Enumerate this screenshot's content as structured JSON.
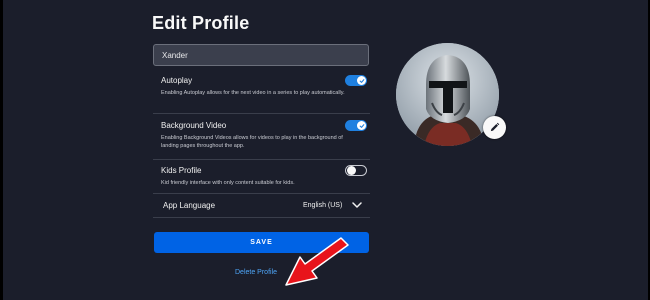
{
  "page": {
    "title": "Edit Profile"
  },
  "profile": {
    "name_value": "Xander"
  },
  "settings": [
    {
      "label": "Autoplay",
      "description": "Enabling Autoplay allows for the next video in a series to play automatically.",
      "enabled": true
    },
    {
      "label": "Background Video",
      "description": "Enabling Background Videos allows for videos to play in the background of landing pages throughout the app.",
      "enabled": true
    },
    {
      "label": "Kids Profile",
      "description": "Kid friendly interface with only content suitable for kids.",
      "enabled": false
    }
  ],
  "language": {
    "label": "App Language",
    "value": "English (US)"
  },
  "actions": {
    "save_label": "SAVE",
    "delete_label": "Delete Profile"
  },
  "colors": {
    "background": "#1b1e2b",
    "accent": "#0063e5",
    "toggle_on": "#1f80e0",
    "link": "#4ea5f7",
    "annotation_arrow": "#e8141b"
  },
  "icons": {
    "avatar": "mandalorian-helmet-avatar",
    "edit": "pencil-icon",
    "dropdown": "chevron-down-icon",
    "toggle_check": "check-icon"
  }
}
